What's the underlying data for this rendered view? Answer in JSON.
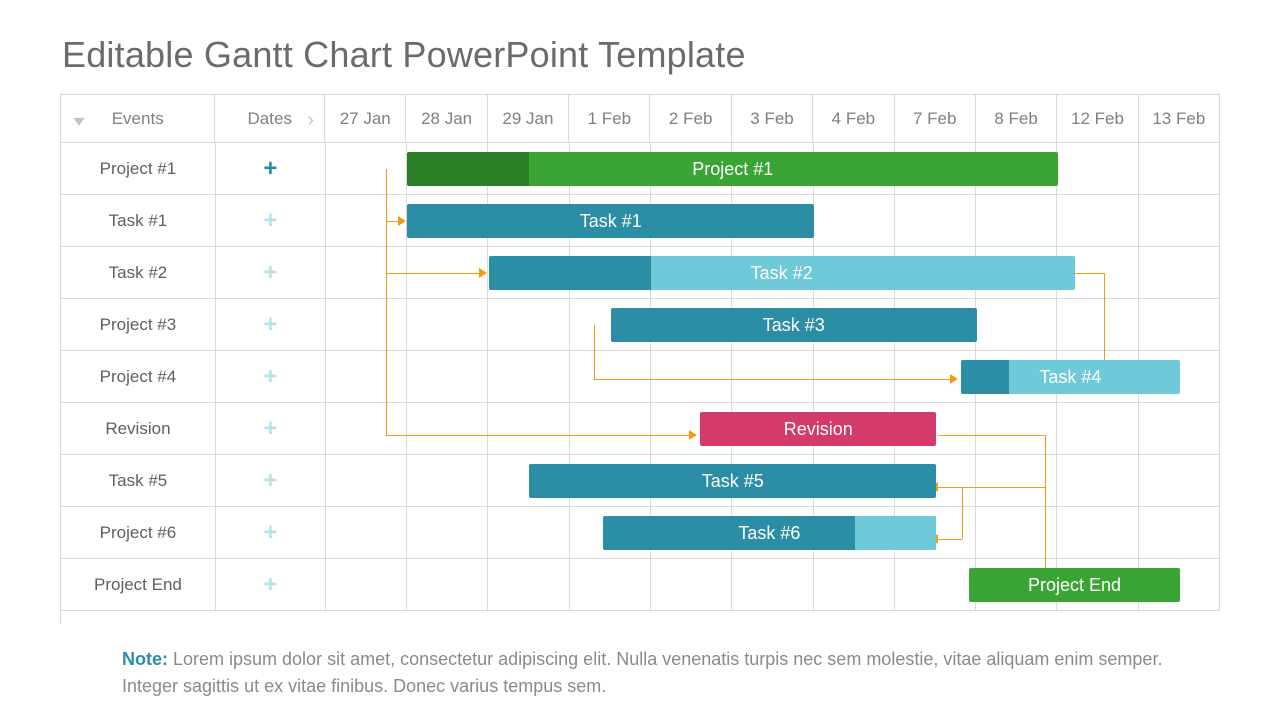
{
  "title": "Editable Gantt Chart PowerPoint Template",
  "headers": {
    "events": "Events",
    "dates": "Dates",
    "days": [
      "27 Jan",
      "28 Jan",
      "29 Jan",
      "1 Feb",
      "2 Feb",
      "3 Feb",
      "4 Feb",
      "7 Feb",
      "8 Feb",
      "12 Feb",
      "13 Feb"
    ]
  },
  "rows": [
    {
      "name": "Project #1",
      "plus": "active"
    },
    {
      "name": "Task #1",
      "plus": "dim"
    },
    {
      "name": "Task #2",
      "plus": "dim"
    },
    {
      "name": "Project #3",
      "plus": "dim"
    },
    {
      "name": "Project #4",
      "plus": "dim"
    },
    {
      "name": "Revision",
      "plus": "dim"
    },
    {
      "name": "Task #5",
      "plus": "dim"
    },
    {
      "name": "Project #6",
      "plus": "dim"
    },
    {
      "name": "Project End",
      "plus": "dim"
    }
  ],
  "bars": [
    {
      "row": 0,
      "label": "Project #1",
      "start": 1,
      "end": 9,
      "bg": "#3aa535",
      "prog_end": 2.5,
      "prog_bg": "#2a7f26"
    },
    {
      "row": 1,
      "label": "Task #1",
      "start": 1,
      "end": 6,
      "bg": "#2b8ea5"
    },
    {
      "row": 2,
      "label": "Task #2",
      "start": 2,
      "end": 9.2,
      "bg": "#6ec9d9",
      "prog_end": 4,
      "prog_bg": "#2b8ea5"
    },
    {
      "row": 3,
      "label": "Task #3",
      "start": 3.5,
      "end": 8,
      "bg": "#2b8ea5"
    },
    {
      "row": 4,
      "label": "Task #4",
      "start": 7.8,
      "end": 10.5,
      "bg": "#6ec9d9",
      "prog_end": 8.4,
      "prog_bg": "#2b8ea5"
    },
    {
      "row": 5,
      "label": "Revision",
      "start": 4.6,
      "end": 7.5,
      "bg": "#d43b6a"
    },
    {
      "row": 6,
      "label": "Task #5",
      "start": 2.5,
      "end": 7.5,
      "bg": "#2b8ea5"
    },
    {
      "row": 7,
      "label": "Task #6",
      "start": 3.4,
      "end": 7.5,
      "bg": "#2b8ea5",
      "overlay_start": 6.5,
      "overlay_end": 7.5,
      "overlay_bg": "#6ec9d9"
    },
    {
      "row": 8,
      "label": "Project End",
      "start": 7.9,
      "end": 10.5,
      "bg": "#3aa535"
    }
  ],
  "note_label": "Note:",
  "note_text": " Lorem ipsum dolor sit amet, consectetur adipiscing elit. Nulla venenatis turpis nec sem molestie, vitae aliquam enim semper. Integer sagittis ut ex vitae finibus. Donec varius tempus sem.",
  "chart_data": {
    "type": "gantt",
    "title": "Editable Gantt Chart PowerPoint Template",
    "x_categories": [
      "27 Jan",
      "28 Jan",
      "29 Jan",
      "1 Feb",
      "2 Feb",
      "3 Feb",
      "4 Feb",
      "7 Feb",
      "8 Feb",
      "12 Feb",
      "13 Feb"
    ],
    "tasks": [
      {
        "name": "Project #1",
        "start": "28 Jan",
        "end": "12 Feb",
        "progress": 0.19,
        "color": "green"
      },
      {
        "name": "Task #1",
        "start": "28 Jan",
        "end": "4 Feb",
        "color": "teal",
        "depends_on": [
          "Project #1"
        ]
      },
      {
        "name": "Task #2",
        "start": "29 Jan",
        "end": "12 Feb",
        "progress": 0.28,
        "color": "teal",
        "depends_on": [
          "Project #1"
        ]
      },
      {
        "name": "Task #3",
        "start": "1 Feb",
        "end": "8 Feb",
        "color": "teal",
        "depends_on": [
          "Task #2"
        ],
        "leads_to": [
          "Task #4"
        ]
      },
      {
        "name": "Task #4",
        "start": "8 Feb",
        "end": "13 Feb",
        "progress": 0.22,
        "color": "teal",
        "depends_on": [
          "Task #2",
          "Task #3"
        ]
      },
      {
        "name": "Revision",
        "start": "2 Feb",
        "end": "8 Feb",
        "color": "magenta",
        "depends_on": [
          "Project #1"
        ]
      },
      {
        "name": "Task #5",
        "start": "29 Jan",
        "end": "8 Feb",
        "color": "teal"
      },
      {
        "name": "Task #6",
        "start": "1 Feb",
        "end": "8 Feb",
        "progress": 0.76,
        "color": "teal"
      },
      {
        "name": "Project End",
        "start": "8 Feb",
        "end": "13 Feb",
        "color": "green",
        "depends_on": [
          "Revision",
          "Task #5",
          "Task #6"
        ]
      }
    ]
  }
}
